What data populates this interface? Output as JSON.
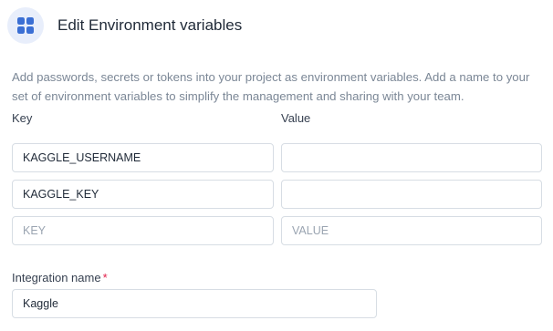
{
  "header": {
    "icon": "grid-apps-icon",
    "title": "Edit Environment variables",
    "accent": "#3b6fd4"
  },
  "description": "Add passwords, secrets or tokens into your project as environment variables. Add a name to your set of environment variables to simplify the management and sharing with your team.",
  "columns": {
    "key_label": "Key",
    "value_label": "Value"
  },
  "rows": [
    {
      "key": "KAGGLE_USERNAME",
      "value": ""
    },
    {
      "key": "KAGGLE_KEY",
      "value": ""
    }
  ],
  "new_row": {
    "key_placeholder": "KEY",
    "value_placeholder": "VALUE"
  },
  "integration": {
    "label": "Integration name",
    "required_marker": "*",
    "value": "Kaggle"
  }
}
